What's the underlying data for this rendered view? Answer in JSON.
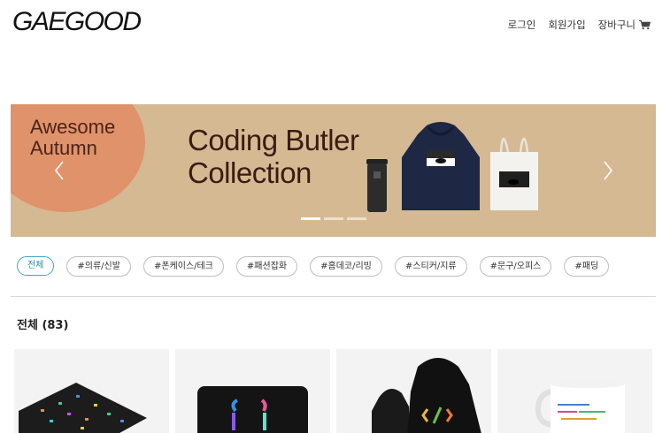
{
  "header": {
    "logo": "GAEGOOD",
    "nav": {
      "login": "로그인",
      "signup": "회원가입",
      "cart": "장바구니"
    }
  },
  "banner": {
    "tag_line1": "Awesome",
    "tag_line2": "Autumn",
    "title_line1": "Coding Butler",
    "title_line2": "Collection",
    "slide_count": 3,
    "active_slide": 1,
    "colors": {
      "background": "#d4b993",
      "circle": "#e0926a"
    }
  },
  "categories": [
    {
      "label": "전체",
      "active": true
    },
    {
      "label": "#의류/신발",
      "active": false
    },
    {
      "label": "#폰케이스/테크",
      "active": false
    },
    {
      "label": "#패션잡화",
      "active": false
    },
    {
      "label": "#홈데코/리빙",
      "active": false
    },
    {
      "label": "#스티커/지류",
      "active": false
    },
    {
      "label": "#문구/오피스",
      "active": false
    },
    {
      "label": "#패딩",
      "active": false
    }
  ],
  "section": {
    "title": "전체 (83)"
  },
  "products": [
    {
      "name": "mousepad-card",
      "icon": "mousepad-art"
    },
    {
      "name": "laptop-sleeve-card",
      "icon": "laptop-sleeve-art"
    },
    {
      "name": "hoodie-card",
      "icon": "hoodie-art"
    },
    {
      "name": "mug-card",
      "icon": "mug-art"
    }
  ],
  "accent_color": "#3ba8c6"
}
